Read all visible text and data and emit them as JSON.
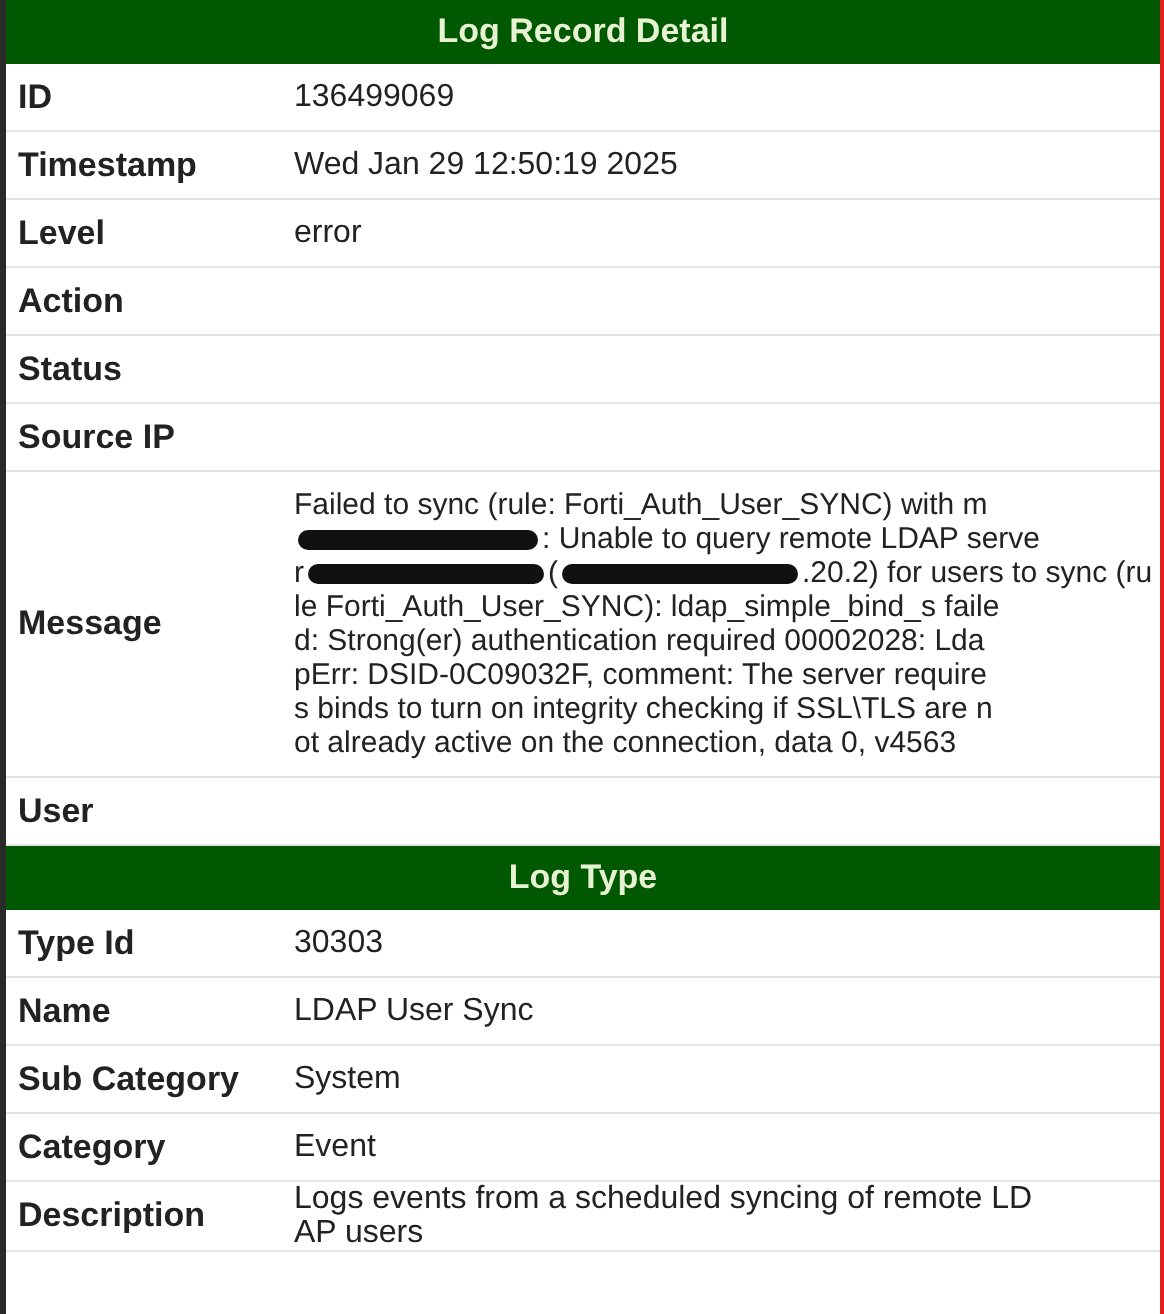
{
  "sections": [
    {
      "title": "Log Record Detail",
      "rows": [
        {
          "label": "ID",
          "value": "136499069"
        },
        {
          "label": "Timestamp",
          "value": "Wed Jan 29 12:50:19 2025"
        },
        {
          "label": "Level",
          "value": "error"
        },
        {
          "label": "Action"
        },
        {
          "label": "Status"
        },
        {
          "label": "Source IP"
        },
        {
          "label": "Message",
          "lines": [
            [
              {
                "kind": "text",
                "text": "Failed to sync (rule: Forti_Auth_User_SYNC) with m"
              }
            ],
            [
              {
                "kind": "redaction"
              },
              {
                "kind": "text",
                "text": ": Unable to query remote LDAP serve"
              }
            ],
            [
              {
                "kind": "text",
                "text": "r"
              },
              {
                "kind": "redaction"
              },
              {
                "kind": "text",
                "text": "("
              },
              {
                "kind": "redaction"
              },
              {
                "kind": "text",
                "text": ".20.2) for users to sync (ru"
              }
            ],
            [
              {
                "kind": "text",
                "text": "le Forti_Auth_User_SYNC): ldap_simple_bind_s faile"
              }
            ],
            [
              {
                "kind": "text",
                "text": "d: Strong(er) authentication required 00002028: Lda"
              }
            ],
            [
              {
                "kind": "text",
                "text": "pErr: DSID-0C09032F, comment: The server require"
              }
            ],
            [
              {
                "kind": "text",
                "text": "s binds to turn on integrity checking if SSL\\TLS are n"
              }
            ],
            [
              {
                "kind": "text",
                "text": "ot already active on the connection, data 0, v4563"
              }
            ]
          ]
        },
        {
          "label": "User"
        }
      ]
    },
    {
      "title": "Log Type",
      "rows": [
        {
          "label": "Type Id",
          "value": "30303"
        },
        {
          "label": "Name",
          "value": "LDAP User Sync"
        },
        {
          "label": "Sub Category",
          "value": "System"
        },
        {
          "label": "Category",
          "value": "Event"
        },
        {
          "label": "Description",
          "value": "Logs events from a scheduled syncing of remote LD\nAP users"
        }
      ]
    }
  ]
}
